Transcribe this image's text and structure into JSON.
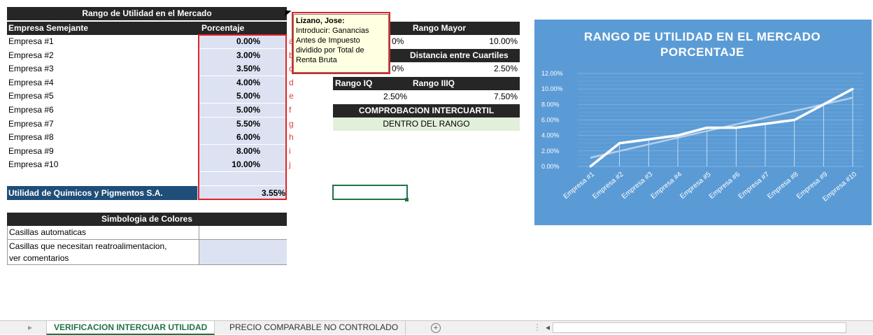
{
  "table": {
    "title": "Rango de Utilidad en el Mercado",
    "col1_header": "Empresa Semejante",
    "col2_header": "Porcentaje",
    "rows": [
      {
        "name": "Empresa #1",
        "value": "0.00%",
        "letter": "a"
      },
      {
        "name": "Empresa #2",
        "value": "3.00%",
        "letter": "b"
      },
      {
        "name": "Empresa #3",
        "value": "3.50%",
        "letter": "c"
      },
      {
        "name": "Empresa #4",
        "value": "4.00%",
        "letter": "d"
      },
      {
        "name": "Empresa #5",
        "value": "5.00%",
        "letter": "e"
      },
      {
        "name": "Empresa #6",
        "value": "5.00%",
        "letter": "f"
      },
      {
        "name": "Empresa #7",
        "value": "5.50%",
        "letter": "g"
      },
      {
        "name": "Empresa #8",
        "value": "6.00%",
        "letter": "h"
      },
      {
        "name": "Empresa #9",
        "value": "8.00%",
        "letter": "i"
      },
      {
        "name": "Empresa #10",
        "value": "10.00%",
        "letter": "j"
      }
    ],
    "utilidad_label": "Utilidad de Quimicos y Pigmentos S.A.",
    "utilidad_value": "3.55%"
  },
  "comment": {
    "author": "Lizano, Jose:",
    "lines": [
      "Introducir: Ganancias",
      "Antes de Impuesto",
      "dividido por Total de",
      "Renta Bruta"
    ]
  },
  "stats": {
    "rango_mayor_label": "Rango Mayor",
    "rango_menor_partial": "0%",
    "rango_mayor_value": "10.00%",
    "distancia_label": "Distancia entre Cuartiles",
    "distancia_partial": "0%",
    "distancia_value": "2.50%",
    "rango_iq_label": "Rango IQ",
    "rango_iiiq_label": "Rango IIIQ",
    "rango_iq_value": "2.50%",
    "rango_iiiq_value": "7.50%",
    "comprobacion_label": "COMPROBACION INTERCUARTIL",
    "comprobacion_result": "DENTRO DEL RANGO"
  },
  "legend_table": {
    "title": "Simbologia de Colores",
    "row1": "Casillas automaticas",
    "row2_line1": "Casillas que necesitan reatroalimentacion,",
    "row2_line2": "ver comentarios"
  },
  "colors": {
    "chart_bg": "#5b9bd5",
    "dark_header": "#262626",
    "input_cell": "#dce2f2",
    "result_cell": "#e2efda",
    "highlight_red": "#e0242a"
  },
  "chart_data": {
    "type": "line",
    "title": "RANGO DE UTILIDAD EN EL MERCADO PORCENTAJE",
    "categories": [
      "Empresa #1",
      "Empresa #2",
      "Empresa #3",
      "Empresa #4",
      "Empresa #5",
      "Empresa #6",
      "Empresa #7",
      "Empresa #8",
      "Empresa #9",
      "Empresa #10"
    ],
    "series": [
      {
        "values": [
          0.0,
          3.0,
          3.5,
          4.0,
          5.0,
          5.0,
          5.5,
          6.0,
          8.0,
          10.0
        ]
      }
    ],
    "trendline": true,
    "y_ticks": [
      "0.00%",
      "2.00%",
      "4.00%",
      "6.00%",
      "8.00%",
      "10.00%",
      "12.00%"
    ],
    "ylim": [
      0,
      12
    ],
    "xlabel": "",
    "ylabel": "",
    "grid": true,
    "legend": "none"
  },
  "sheet_tabs": {
    "active": "VERIFICACION INTERCUAR UTILIDAD",
    "other": "PRECIO COMPARABLE NO CONTROLADO",
    "add_symbol": "+"
  }
}
